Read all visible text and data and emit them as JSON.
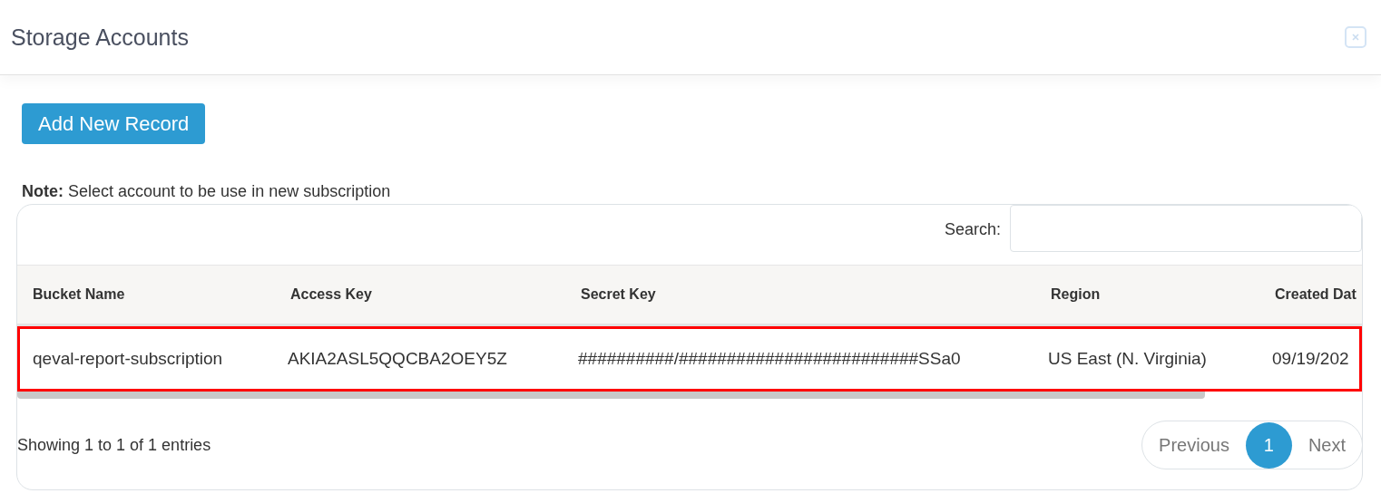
{
  "window": {
    "title": "Storage Accounts"
  },
  "add_button": "Add New Record",
  "note": "**Note:** Select account to be use in new subscription",
  "search": {
    "label": "Search:"
  },
  "table": {
    "columns": [
      "Bucket Name",
      "Access Key",
      "Secret Key",
      "Region",
      "Created Dat"
    ],
    "rows": [
      {
        "cells": [
          "qeval-report-subscription",
          "AKIA2ASL5QQCBA2OEY5Z",
          "##########/#########################SSa0",
          "US East (N. Virginia)",
          "09/19/202"
        ],
        "selected": true
      }
    ]
  },
  "info": "Showing 1 to 1 of 1 entries",
  "pagination": {
    "previous": "Previous",
    "pages": [
      {
        "label": "1",
        "selected": true
      }
    ],
    "next": "Next"
  }
}
